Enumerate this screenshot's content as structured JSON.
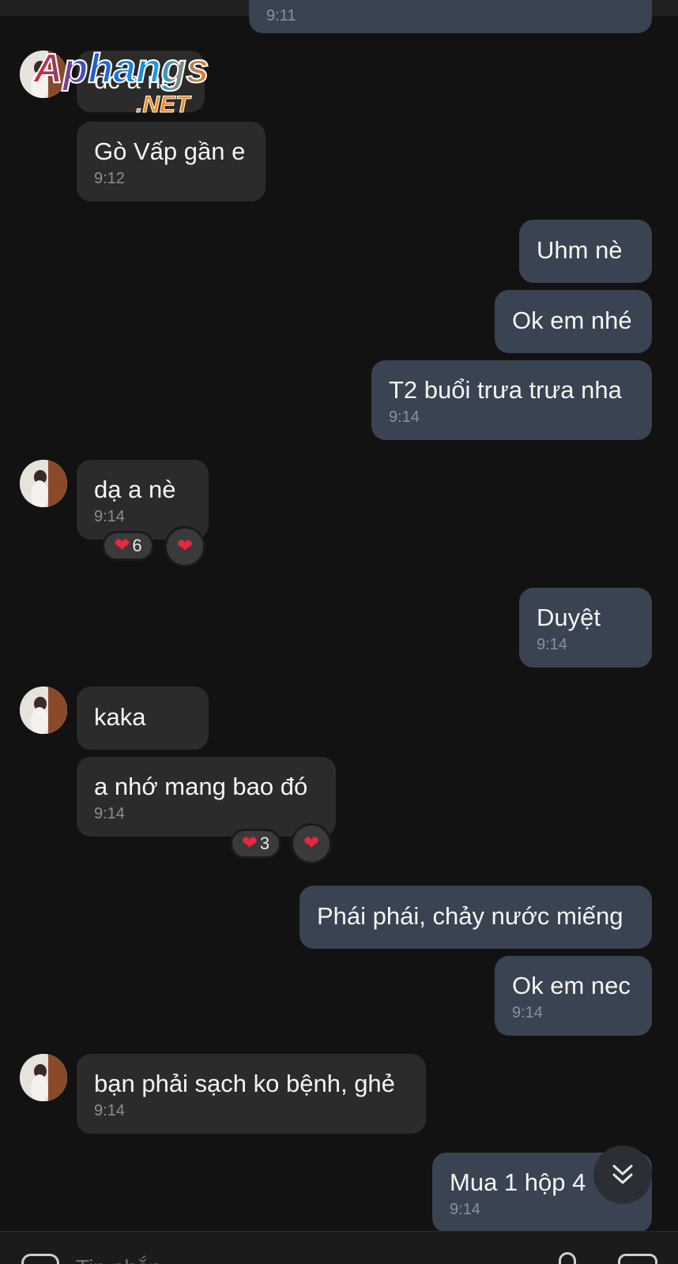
{
  "watermark": {
    "logo_text": "Aphangs",
    "logo_suffix": ".NET"
  },
  "messages": [
    {
      "side": "out",
      "text": "",
      "time": "9:11"
    },
    {
      "side": "in",
      "text": "đc a nè",
      "time": ""
    },
    {
      "side": "in",
      "text": "Gò Vấp gần e",
      "time": "9:12"
    },
    {
      "side": "out",
      "text": "Uhm nè",
      "time": ""
    },
    {
      "side": "out",
      "text": "Ok em nhé",
      "time": ""
    },
    {
      "side": "out",
      "text": "T2 buổi trưa trưa nha",
      "time": "9:14"
    },
    {
      "side": "in",
      "text": "dạ a nè",
      "time": "9:14",
      "reaction_count": "6"
    },
    {
      "side": "out",
      "text": "Duyệt",
      "time": "9:14"
    },
    {
      "side": "in",
      "text": "kaka",
      "time": ""
    },
    {
      "side": "in",
      "text": "a nhớ mang bao đó",
      "time": "9:14",
      "reaction_count": "3"
    },
    {
      "side": "out",
      "text": "Phái phái, chảy nước miếng",
      "time": ""
    },
    {
      "side": "out",
      "text": "Ok em nec",
      "time": "9:14"
    },
    {
      "side": "in",
      "text": "bạn phải sạch ko bệnh, ghẻ",
      "time": "9:14"
    },
    {
      "side": "out",
      "text": "Mua 1 hộp 4",
      "time": "9:14"
    }
  ],
  "composer": {
    "placeholder": "Tin nhắn"
  },
  "colors": {
    "background": "#121212",
    "incoming_bubble": "#2b2b2b",
    "outgoing_bubble": "#394352",
    "heart": "#e8263d"
  },
  "icons": {
    "reaction": "heart-icon",
    "scroll_down": "double-chevron-down-icon"
  }
}
